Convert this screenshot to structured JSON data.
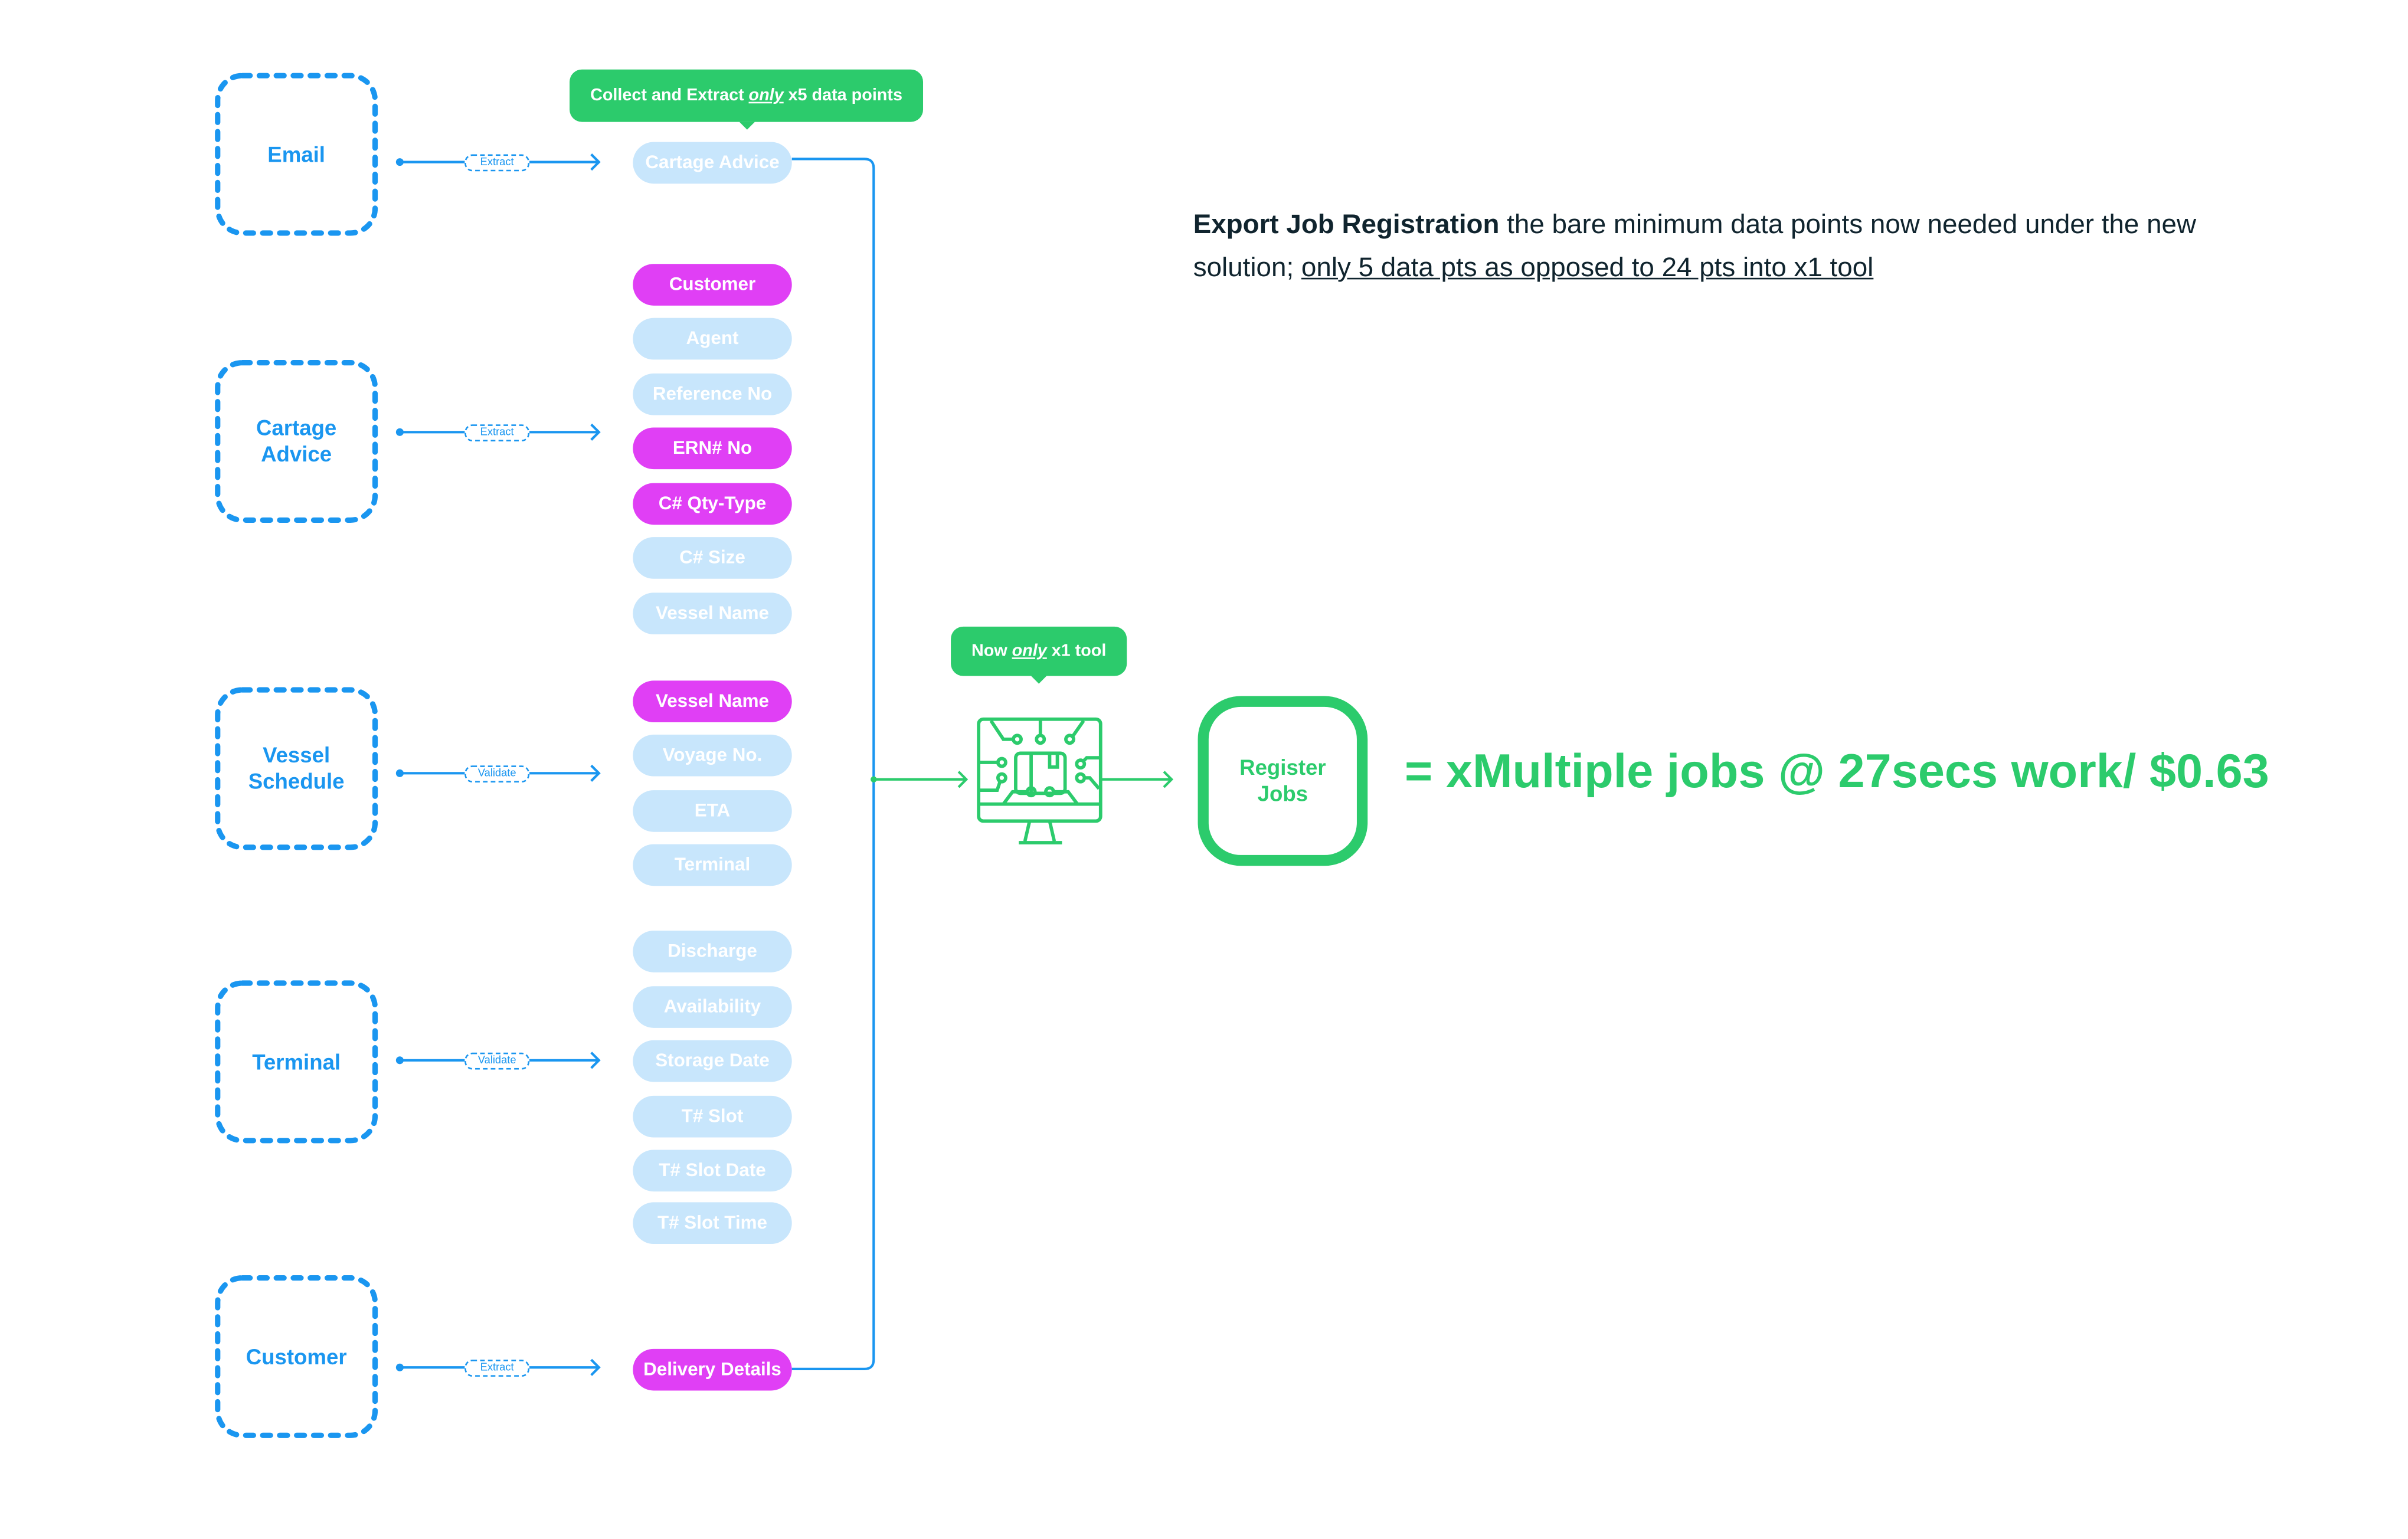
{
  "colors": {
    "blue": "#1a96f0",
    "green": "#2ccb6c",
    "magenta": "#e03ff5",
    "light_blue": "#c8e6fc"
  },
  "sources": [
    {
      "label": "Email",
      "action": "Extract"
    },
    {
      "label": "Cartage Advice",
      "action": "Extract"
    },
    {
      "label": "Vessel Schedule",
      "action": "Validate"
    },
    {
      "label": "Terminal",
      "action": "Validate"
    },
    {
      "label": "Customer",
      "action": "Extract"
    }
  ],
  "data_points": [
    {
      "label": "Cartage Advice",
      "selected": false
    },
    {
      "label": "Customer",
      "selected": true
    },
    {
      "label": "Agent",
      "selected": false
    },
    {
      "label": "Reference No",
      "selected": false
    },
    {
      "label": "ERN# No",
      "selected": true
    },
    {
      "label": "C# Qty-Type",
      "selected": true
    },
    {
      "label": "C# Size",
      "selected": false
    },
    {
      "label": "Vessel Name",
      "selected": false
    },
    {
      "label": "Vessel Name",
      "selected": true
    },
    {
      "label": "Voyage No.",
      "selected": false
    },
    {
      "label": "ETA",
      "selected": false
    },
    {
      "label": "Terminal",
      "selected": false
    },
    {
      "label": "Discharge",
      "selected": false
    },
    {
      "label": "Availability",
      "selected": false
    },
    {
      "label": "Storage Date",
      "selected": false
    },
    {
      "label": "T# Slot",
      "selected": false
    },
    {
      "label": "T# Slot Date",
      "selected": false
    },
    {
      "label": "T# Slot Time",
      "selected": false
    },
    {
      "label": "Delivery Details",
      "selected": true
    }
  ],
  "callout_collect": {
    "before": "Collect and Extract",
    "em": "only",
    "after": "x5 data points"
  },
  "callout_tool": {
    "before": "Now",
    "em": "only",
    "after": "x1 tool"
  },
  "tool_icon": "computer-circuit-icon",
  "register": {
    "line1": "Register",
    "line2": "Jobs"
  },
  "result": "= xMultiple jobs @ 27secs work/ $0.63",
  "description": {
    "bold": "Export Job Registration",
    "text": " the bare minimum data points now needed under the new solution; ",
    "underlined": "only 5 data pts as opposed to 24 pts into x1 tool"
  }
}
